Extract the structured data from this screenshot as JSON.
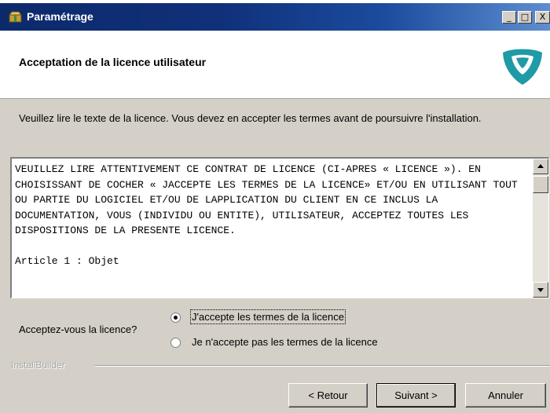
{
  "window": {
    "title": "Paramétrage",
    "controls": {
      "minimize": "_",
      "maximize": "□",
      "close": "X"
    }
  },
  "header": {
    "title": "Acceptation de la licence utilisateur",
    "logo_icon": "teal-shield-logo",
    "logo_color": "#1f9aa7"
  },
  "intro": "Veuillez lire le texte de la licence. Vous devez en accepter les termes avant de poursuivre l'installation.",
  "license": {
    "text": "VEUILLEZ LIRE ATTENTIVEMENT CE CONTRAT DE LICENCE (CI-APRES « LICENCE »). EN CHOISISSANT DE COCHER « JACCEPTE LES TERMES DE LA LICENCE» ET/OU EN UTILISANT TOUT OU PARTIE DU LOGICIEL ET/OU DE LAPPLICATION DU CLIENT EN CE INCLUS LA DOCUMENTATION, VOUS (INDIVIDU OU ENTITE), UTILISATEUR, ACCEPTEZ TOUTES LES DISPOSITIONS DE LA PRESENTE LICENCE.\n\nArticle 1 : Objet"
  },
  "acceptance": {
    "question": "Acceptez-vous la licence?",
    "options": [
      {
        "label": "J'accepte les termes de la licence",
        "selected": true
      },
      {
        "label": "Je n'accepte pas les termes de la licence",
        "selected": false
      }
    ]
  },
  "brand": "InstallBuilder",
  "buttons": {
    "back": "< Retour",
    "next": "Suivant >",
    "cancel": "Annuler"
  }
}
